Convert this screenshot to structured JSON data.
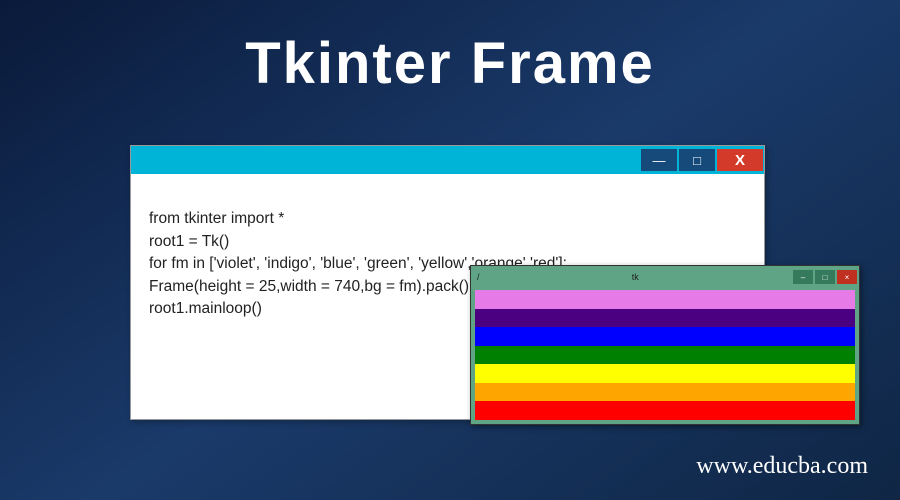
{
  "title": "Tkinter Frame",
  "code_window": {
    "lines": [
      "from tkinter import *",
      "root1 = Tk()",
      "for fm in ['violet', 'indigo', 'blue', 'green', 'yellow','orange','red']:",
      "Frame(height = 25,width = 740,bg = fm).pack()",
      "root1.mainloop()"
    ],
    "min_label": "—",
    "max_label": "□",
    "close_label": "X"
  },
  "output_window": {
    "title_left": "/",
    "title_center": "tk",
    "min_label": "–",
    "max_label": "□",
    "close_label": "×",
    "stripes": [
      {
        "name": "violet",
        "color": "#e67ae6"
      },
      {
        "name": "indigo",
        "color": "#4b0082"
      },
      {
        "name": "blue",
        "color": "#0000ff"
      },
      {
        "name": "green",
        "color": "#008000"
      },
      {
        "name": "yellow",
        "color": "#ffff00"
      },
      {
        "name": "orange",
        "color": "#ffa500"
      },
      {
        "name": "red",
        "color": "#ff0000"
      }
    ]
  },
  "url": "www.educba.com"
}
